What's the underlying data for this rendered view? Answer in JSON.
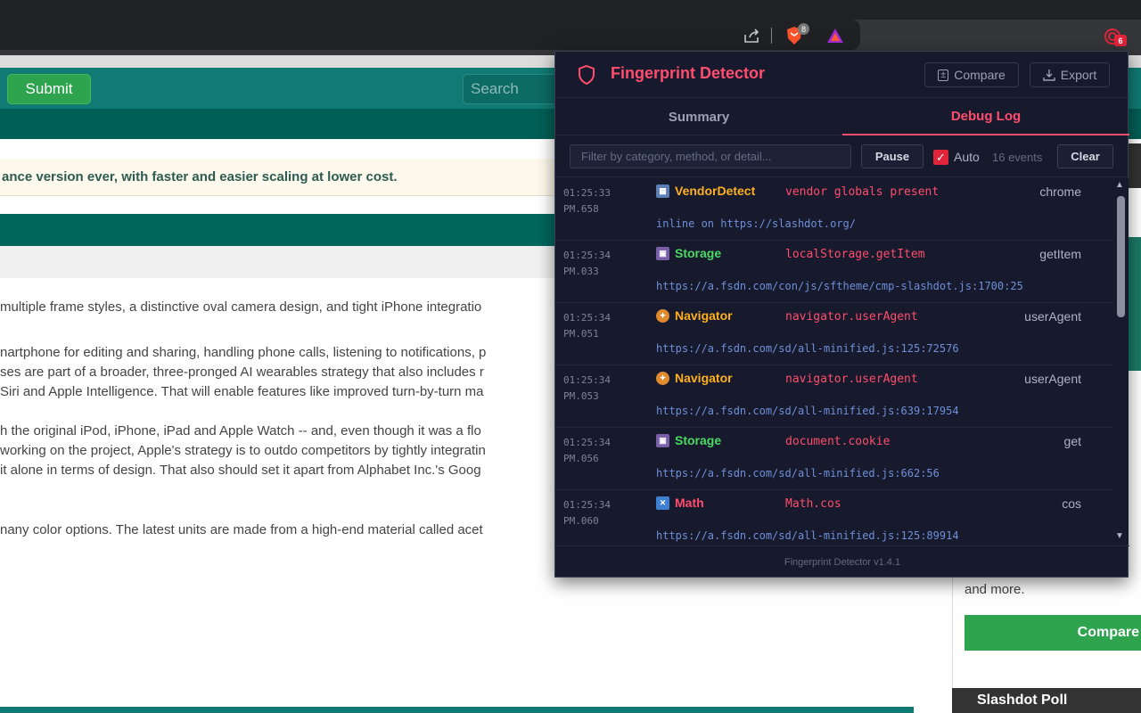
{
  "browser": {
    "extensions_badge": "6",
    "brave_badge": "8"
  },
  "site": {
    "submit_label": "Submit",
    "search_placeholder": "Search",
    "notice": "ance version ever, with faster and easier scaling at lower cost.",
    "paragraphs": [
      "multiple frame styles, a distinctive oval camera design, and tight iPhone integratio",
      "nartphone for editing and sharing, handling phone calls, listening to notifications, p",
      "ses are part of a broader, three-pronged AI wearables strategy that also includes r",
      "Siri and Apple Intelligence. That will enable features like improved turn-by-turn ma",
      "h the original iPod, iPhone, iPad and Apple Watch -- and, even though it was a flo",
      "working on the project, Apple's strategy is to outdo competitors by tightly integratin",
      "it alone in terms of design. That also should set it apart from Alphabet Inc.'s Goog",
      "nany color options. The latest units are made from a high-end material called acet"
    ],
    "and_more": "and more.",
    "compare_label": "Compare",
    "poll_title": "Slashdot Poll"
  },
  "popup": {
    "title": "Fingerprint Detector",
    "compare_label": "Compare",
    "export_label": "Export",
    "tabs": [
      "Summary",
      "Debug Log"
    ],
    "active_tab": "Debug Log",
    "filter_placeholder": "Filter by category, method, or detail...",
    "pause_label": "Pause",
    "auto_label": "Auto",
    "auto_checked": true,
    "event_count": "16 events",
    "clear_label": "Clear",
    "entries": [
      {
        "time": "01:25:33",
        "time2": "PM.658",
        "icon": "building-icon",
        "category": "VendorDetect",
        "category_color": "#ffb020",
        "method": "vendor globals present",
        "detail": "chrome",
        "source": "inline on https://slashdot.org/"
      },
      {
        "time": "01:25:34",
        "time2": "PM.033",
        "icon": "floppy-icon",
        "category": "Storage",
        "category_color": "#4cd964",
        "method": "localStorage.getItem",
        "detail": "getItem",
        "source": "https://a.fsdn.com/con/js/sftheme/cmp-slashdot.js:1700:25"
      },
      {
        "time": "01:25:34",
        "time2": "PM.051",
        "icon": "compass-icon",
        "category": "Navigator",
        "category_color": "#ffb020",
        "method": "navigator.userAgent",
        "detail": "userAgent",
        "source": "https://a.fsdn.com/sd/all-minified.js:125:72576"
      },
      {
        "time": "01:25:34",
        "time2": "PM.053",
        "icon": "compass-icon",
        "category": "Navigator",
        "category_color": "#ffb020",
        "method": "navigator.userAgent",
        "detail": "userAgent",
        "source": "https://a.fsdn.com/sd/all-minified.js:639:17954"
      },
      {
        "time": "01:25:34",
        "time2": "PM.056",
        "icon": "floppy-icon",
        "category": "Storage",
        "category_color": "#4cd964",
        "method": "document.cookie",
        "detail": "get",
        "source": "https://a.fsdn.com/sd/all-minified.js:662:56"
      },
      {
        "time": "01:25:34",
        "time2": "PM.060",
        "icon": "math-icon",
        "category": "Math",
        "category_color": "#ff4d6d",
        "method": "Math.cos",
        "detail": "cos",
        "source": "https://a.fsdn.com/sd/all-minified.js:125:89914"
      }
    ],
    "footer": "Fingerprint Detector v1.4.1"
  }
}
